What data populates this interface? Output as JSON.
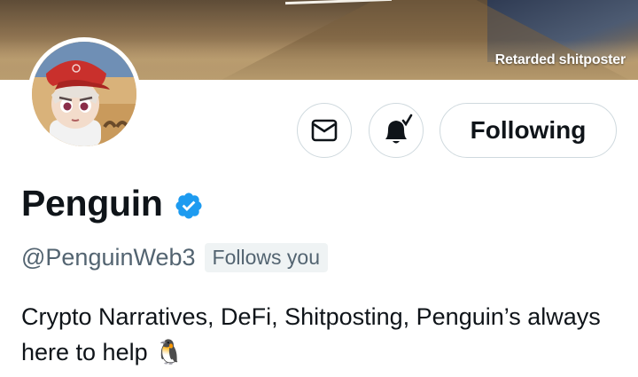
{
  "banner": {
    "caption": "Retarded shitposter"
  },
  "profile": {
    "display_name": "Penguin",
    "handle": "@PenguinWeb3",
    "follows_you_badge": "Follows you",
    "bio": "Crypto Narratives, DeFi, Shitposting, Penguin’s always here to help 🐧",
    "verified": true
  },
  "actions": {
    "message_icon": "mail-icon",
    "notifications_icon": "bell-check-icon",
    "follow_label": "Following"
  },
  "colors": {
    "verified_badge": "#1d9bf0",
    "secondary_text": "#536471",
    "border": "#cfd9de"
  }
}
